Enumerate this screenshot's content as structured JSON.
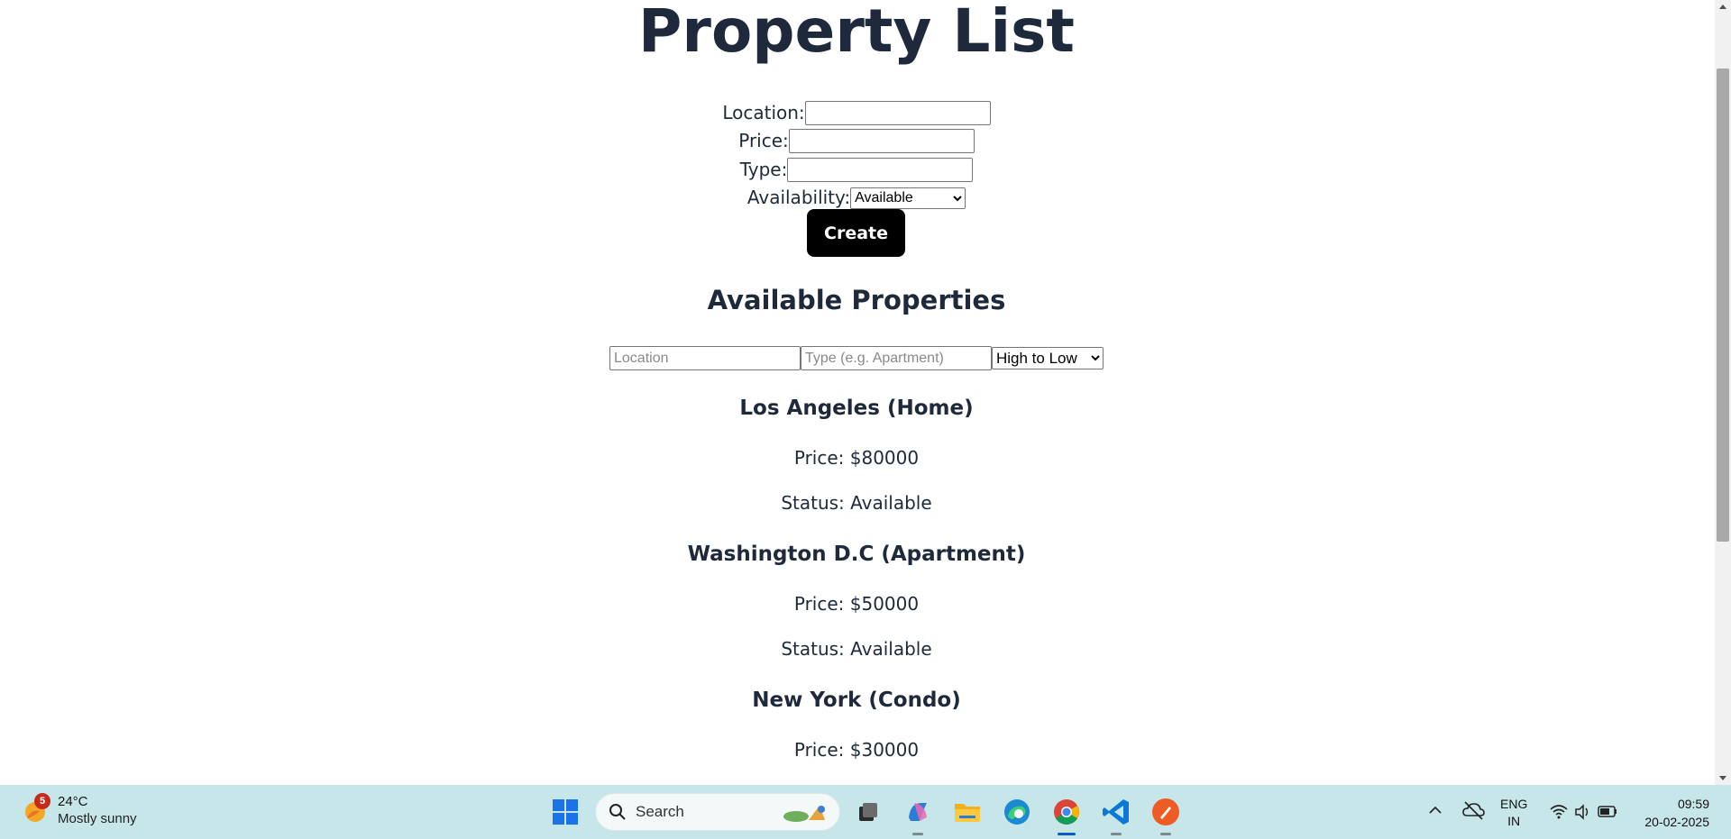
{
  "page": {
    "title": "Property List",
    "form": {
      "location_label": "Location:",
      "location_value": "",
      "price_label": "Price:",
      "price_value": "",
      "type_label": "Type:",
      "type_value": "",
      "availability_label": "Availability:",
      "availability_selected": "Available",
      "create_label": "Create"
    },
    "section_title": "Available Properties",
    "filters": {
      "location_placeholder": "Location",
      "type_placeholder": "Type (e.g. Apartment)",
      "sort_selected": "High to Low"
    },
    "properties": [
      {
        "title": "Los Angeles (Home)",
        "price": "Price: $80000",
        "status": "Status: Available"
      },
      {
        "title": "Washington D.C (Apartment)",
        "price": "Price: $50000",
        "status": "Status: Available"
      },
      {
        "title": "New York (Condo)",
        "price": "Price: $30000"
      }
    ]
  },
  "taskbar": {
    "weather": {
      "badge": "5",
      "temp": "24°C",
      "desc": "Mostly sunny"
    },
    "search_label": "Search",
    "apps": [
      "file-explorer",
      "copilot",
      "folder",
      "edge",
      "chrome",
      "vscode",
      "postman"
    ],
    "lang_top": "ENG",
    "lang_bottom": "IN",
    "time": "09:59",
    "date": "20-02-2025"
  },
  "colors": {
    "text": "#1e2a3b",
    "button_bg": "#000000",
    "taskbar_bg": "#c7e6ea"
  }
}
